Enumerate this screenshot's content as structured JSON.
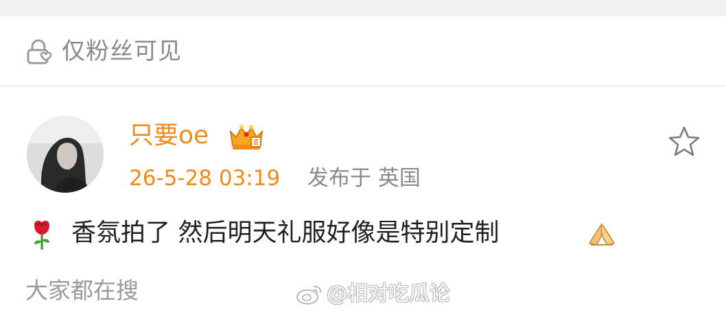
{
  "visibility": {
    "icon": "lock-heart-icon",
    "label": "仅粉丝可见"
  },
  "post": {
    "author": {
      "name": "只要oe",
      "badge": "vip-crown-badge-icon",
      "avatar": "avatar-photo"
    },
    "timestamp": "26-5-28 03:19",
    "location": "发布于 英国",
    "content": {
      "leading_emoji": "rose-icon",
      "text": "香氛拍了 然后明天礼服好像是特别定制",
      "trailing_emoji": "pray-hands-icon"
    },
    "favorite_icon": "star-outline-icon"
  },
  "trending": {
    "label": "大家都在搜"
  },
  "watermark": {
    "text": "@相对吃瓜论"
  },
  "colors": {
    "accent": "#f08a1c",
    "secondary_text": "#8a8a8a",
    "divider": "#e6e6e6",
    "top_gap": "#f1f1f1"
  }
}
